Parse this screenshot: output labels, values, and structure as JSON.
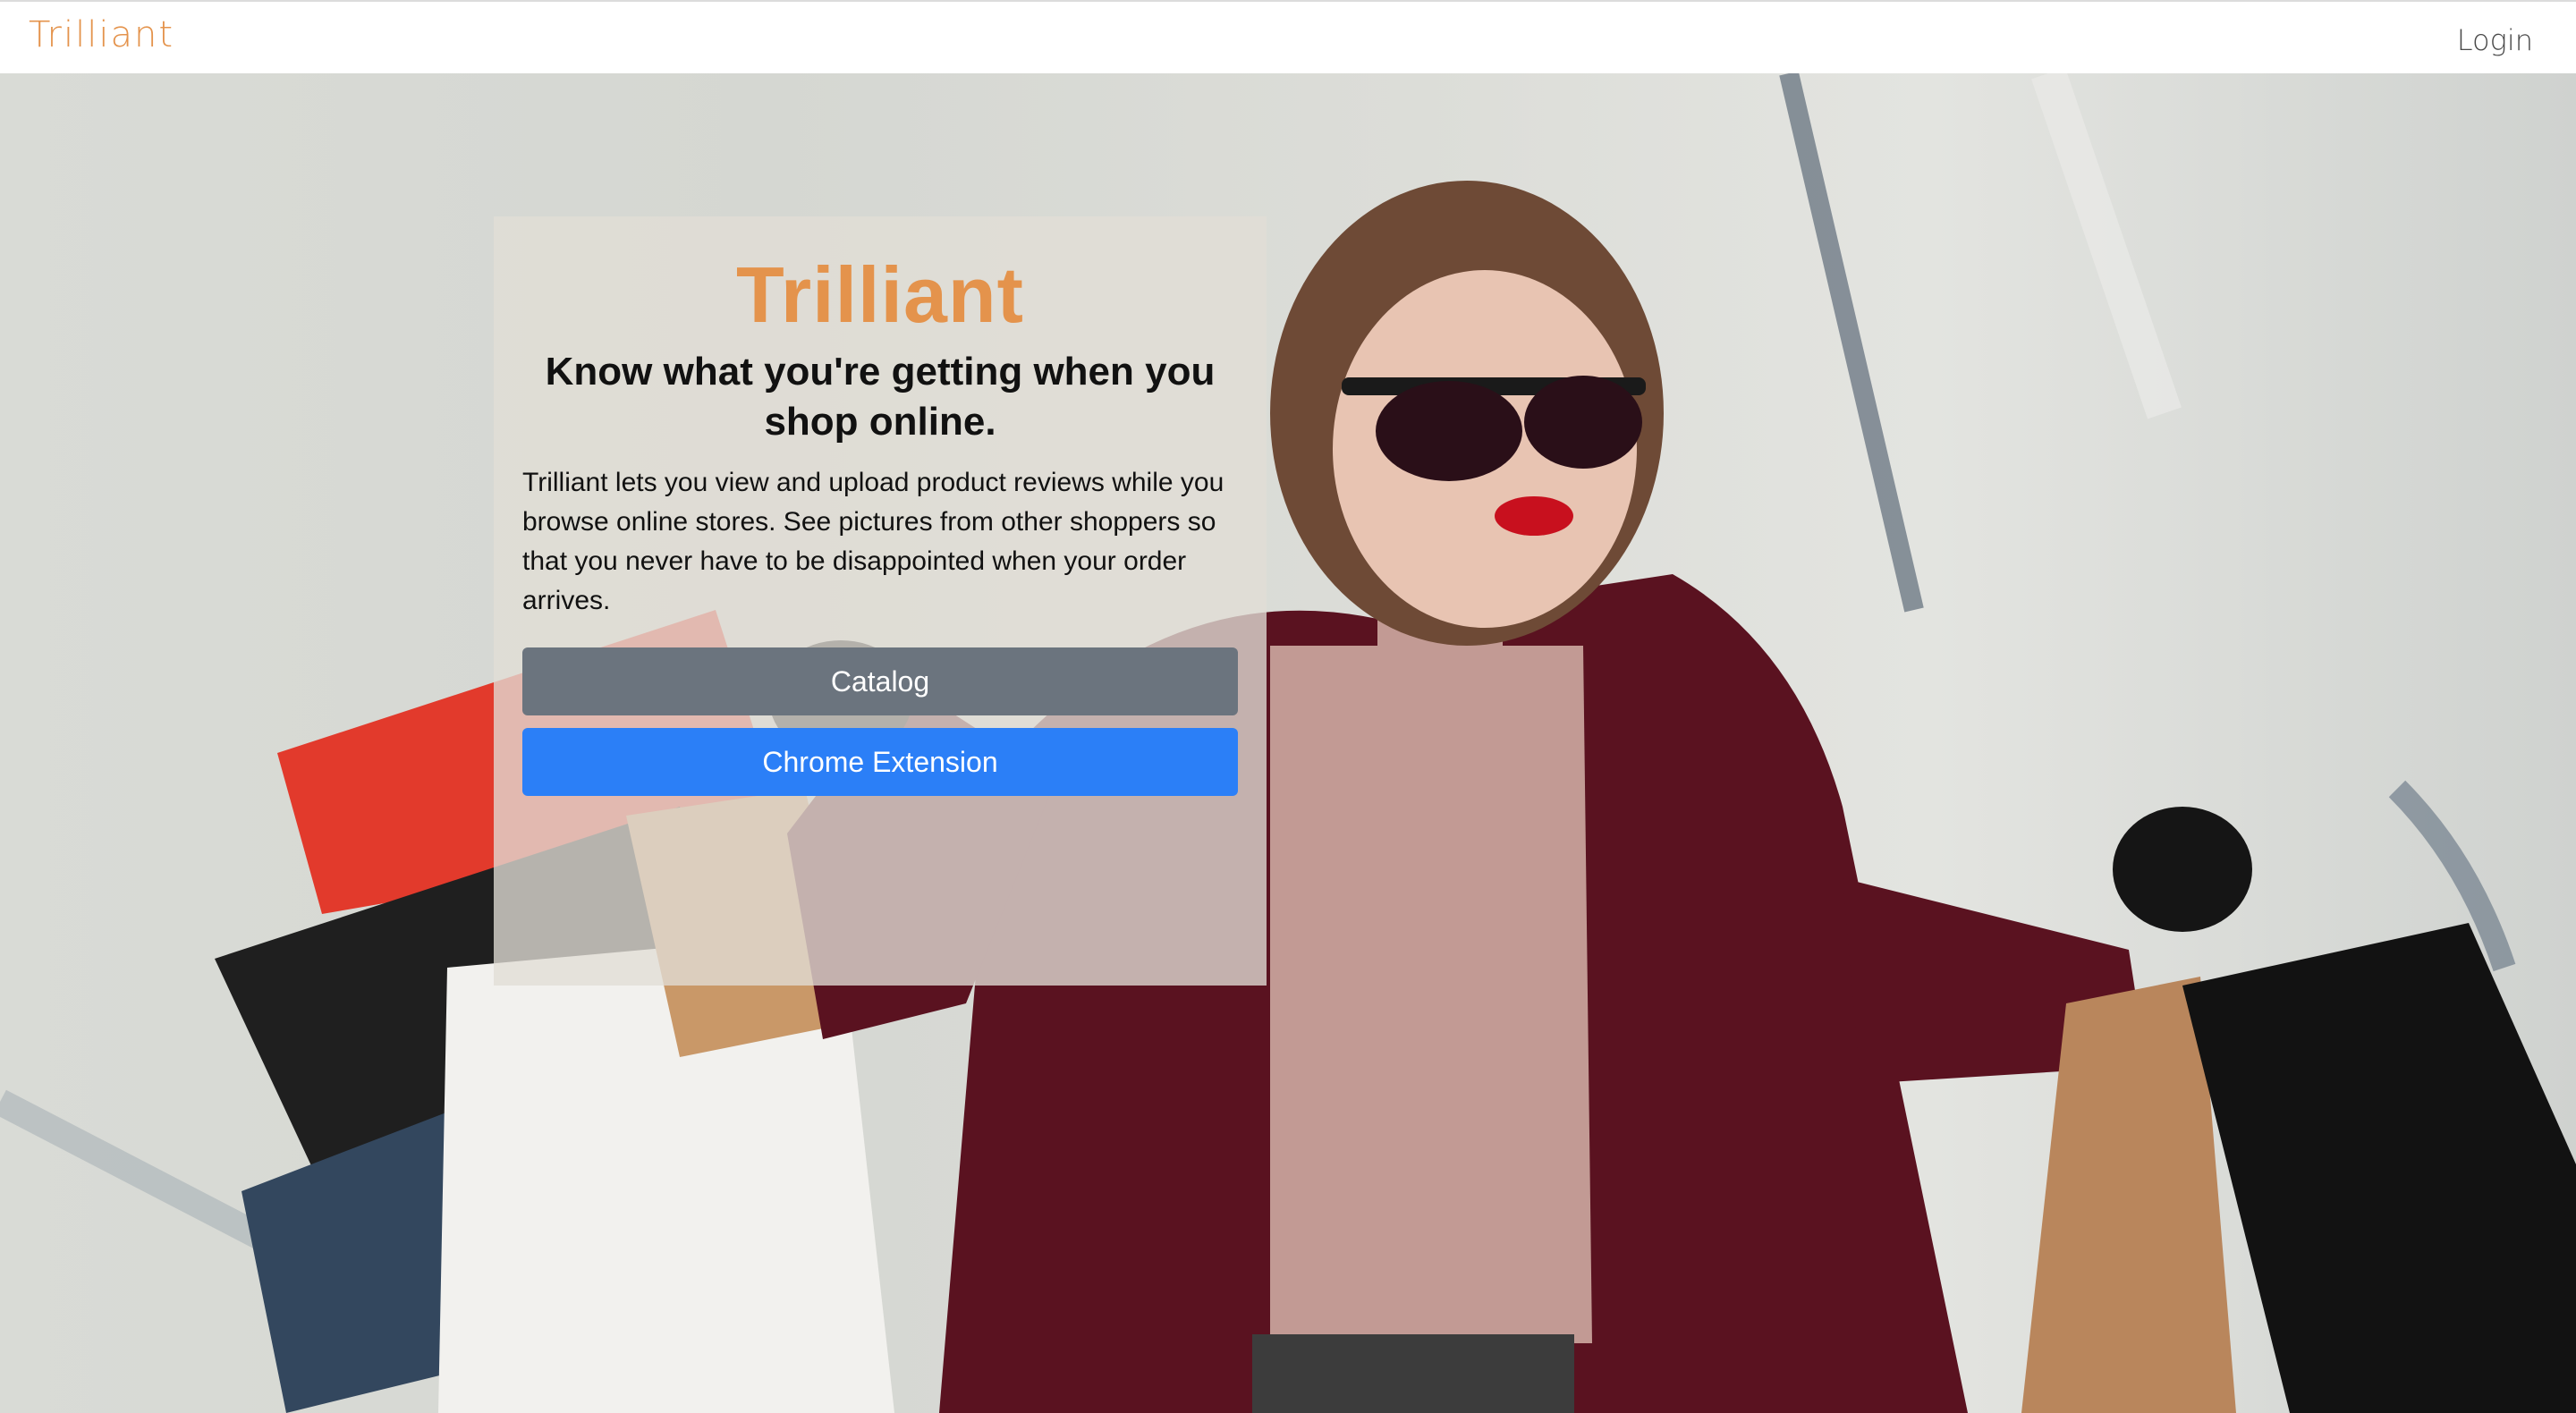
{
  "navbar": {
    "brand": "Trilliant",
    "login_label": "Login"
  },
  "hero": {
    "background_image": "woman-with-shopping-bags-photo",
    "card": {
      "title": "Trilliant",
      "subtitle": "Know what you're getting when you shop online.",
      "body": "Trilliant lets you view and upload product reviews while you browse online stores. See pictures from other shoppers so that you never have to be disappointed when your order arrives.",
      "catalog_label": "Catalog",
      "chrome_label": "Chrome Extension"
    }
  },
  "colors": {
    "brand": "#e4934c",
    "catalog_button": "#6b747e",
    "chrome_button": "#2b7ff7",
    "coat": "#5a1220"
  }
}
